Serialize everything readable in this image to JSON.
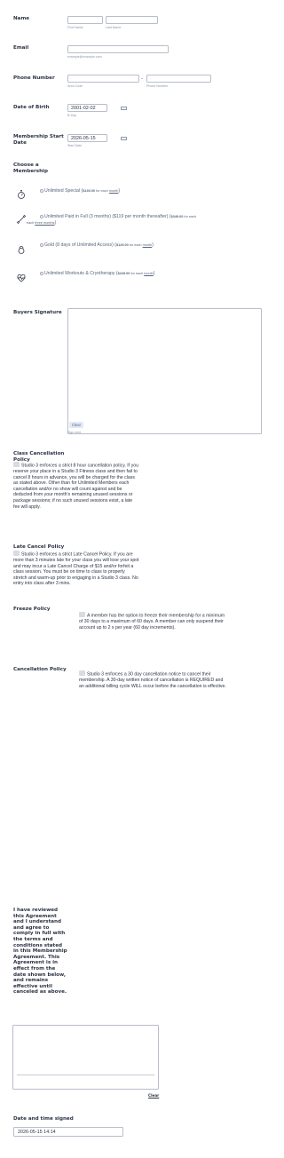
{
  "name": {
    "label": "Name",
    "first_sub": "First Name",
    "last_sub": "Last Name"
  },
  "email": {
    "label": "Email",
    "placeholder_sub": "example@example.com"
  },
  "phone": {
    "label": "Phone Number",
    "area_sub": "Area Code",
    "number_sub": "Phone Number",
    "separator": "-"
  },
  "dob": {
    "label": "Date of Birth",
    "value": "2001-02-02",
    "sub": "B-Day"
  },
  "start": {
    "label": "Membership Start Date",
    "value": "2026-05-15",
    "sub": "Start Date"
  },
  "membership": {
    "label": "Choose a Membership",
    "options": [
      {
        "title": "Unlimited Special (",
        "price": "$139.00",
        "per": " for each ",
        "period": "month",
        "close": ")"
      },
      {
        "title": "Unlimited Paid in Full (3 months) ($119 per month thereafter) (",
        "price": "$349.00",
        "per": " for each ",
        "period": "three months",
        "close": ")"
      },
      {
        "title": "Gold (8 days of Unlimited Access) (",
        "price": "$129.00",
        "per": " for each ",
        "period": "month",
        "close": ")"
      },
      {
        "title": "Unlimited Workouts & Cryotherapy (",
        "price": "$249.00",
        "per": " for each ",
        "period": "month",
        "close": ")"
      }
    ]
  },
  "signature": {
    "label": "Buyers Signature",
    "clear": "Clear",
    "sub": "Sign here"
  },
  "class_cancel": {
    "label": "Class Cancellation Policy",
    "text": "Studio 3 enforces a strict 8 hour cancellation policy. If you reserve your place in a Studio 3 Fitness class and then fail to cancel 8 hours in advance, you will be charged for the class as stated above. Other than for Unlimited Members each cancellation and/or no show will count against and be deducted from your month's remaining unused sessions or package sessions; if no such unused sessions exist, a late fee will apply."
  },
  "late_cancel": {
    "label": "Late Cancel Policy",
    "text": "Studio 3 enforces a strict Late Cancel Policy. If you are more than 3 minutes late for your class you will lose your spot and may incur a Late Cancel Charge of $15 and/or forfeit a class session. You must be on time to class to properly stretch and warm-up prior to engaging in a Studio 3 class. No entry into class after 3 mins."
  },
  "freeze": {
    "label": "Freeze Policy",
    "text": "A member has the option to freeze their membership for a minimum of 30 days to a maximum of 60 days. A member can only suspend their account up to 2 x per year (60 day increments)."
  },
  "cancellation": {
    "label": "Cancellation Policy",
    "text": "Studio 3 enforces a 30 day cancellation notice to cancel their membership. A 30-day written notice of cancellation is REQUIRED and an additional billing cycle WILL occur before the cancellation is effective."
  },
  "agreement": {
    "label": "I have reviewed this Agreement and I understand and agree to comply in full with the terms and conditions stated in this Membership Agreement. This Agreement is in effect from the date shown below, and remains effective until canceled as above.",
    "clear": "Clear"
  },
  "signed": {
    "label": "Date and time signed",
    "value": "2026-05-15 14:14"
  }
}
